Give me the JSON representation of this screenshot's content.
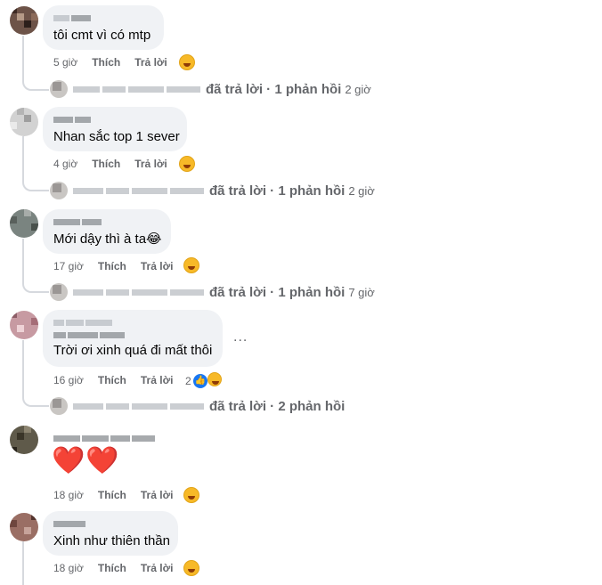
{
  "meta": {
    "like": "Thích",
    "reply": "Trả lời"
  },
  "comments": [
    {
      "text": "tôi cmt vì có mtp",
      "time": "5 giờ",
      "reply_summary": "đã trả lời · 1 phản hồi",
      "reply_time": "2 giờ"
    },
    {
      "text": "Nhan sắc top 1 sever",
      "time": "4 giờ",
      "reply_summary": "đã trả lời · 1 phản hồi",
      "reply_time": "2 giờ"
    },
    {
      "text": "Mới dậy thì à ta😂",
      "time": "17 giờ",
      "reply_summary": "đã trả lời · 1 phản hồi",
      "reply_time": "7 giờ"
    },
    {
      "text": "Trời ơi xinh quá đi mất thôi",
      "time": "16 giờ",
      "reaction_count": "2",
      "more": "...",
      "reply_summary": "đã trả lời · 2 phản hồi"
    },
    {
      "text": "❤️❤️",
      "time": "18 giờ"
    },
    {
      "text": "Xinh như thiên thần",
      "time": "18 giờ"
    }
  ],
  "icons": {
    "reaction": "care-emoji-icon",
    "laugh": "laugh-emoji-icon",
    "like": "like-icon"
  },
  "colors": {
    "bubble": "#f0f2f5",
    "meta": "#65676b",
    "like_blue": "#1877f2"
  }
}
